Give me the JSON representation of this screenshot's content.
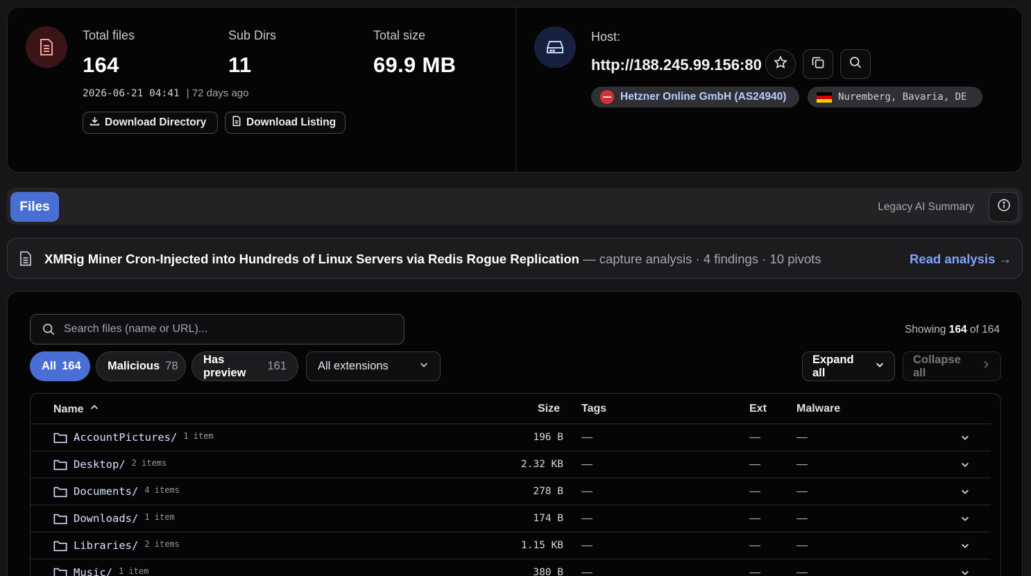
{
  "summary": {
    "total_files_label": "Total files",
    "total_files_value": "164",
    "sub_dirs_label": "Sub Dirs",
    "sub_dirs_value": "11",
    "total_size_label": "Total size",
    "total_size_value": "69.9 MB",
    "timestamp": "2026-06-21 04:41",
    "relative_time": "| 72 days ago",
    "download_directory_label": "Download Directory",
    "download_listing_label": "Download Listing"
  },
  "host": {
    "label": "Host:",
    "url": "http://188.245.99.156:80",
    "asn": "Hetzner Online GmbH (AS24940)",
    "location": "Nuremberg, Bavaria, DE",
    "flag_colors": [
      "#000000",
      "#dd0000",
      "#ffce00"
    ]
  },
  "tabs": {
    "files_label": "Files",
    "legacy_label": "Legacy AI Summary"
  },
  "banner": {
    "title": "XMRig Miner Cron-Injected into Hundreds of Linux Servers via Redis Rogue Replication",
    "meta": " — capture analysis · 4 findings · 10 pivots",
    "link": "Read analysis →"
  },
  "files": {
    "search_placeholder": "Search files (name or URL)...",
    "showing_prefix": "Showing ",
    "showing_count": "164",
    "showing_suffix": " of 164",
    "filters": {
      "all_label": "All",
      "all_count": "164",
      "malicious_label": "Malicious",
      "malicious_count": "78",
      "preview_label": "Has preview",
      "preview_count": "161",
      "extensions_label": "All extensions"
    },
    "expand_all": "Expand all",
    "collapse_all": "Collapse all",
    "columns": {
      "name": "Name",
      "size": "Size",
      "tags": "Tags",
      "ext": "Ext",
      "malware": "Malware"
    },
    "rows": [
      {
        "name": "AccountPictures/",
        "count": "1 item",
        "size": "196 B"
      },
      {
        "name": "Desktop/",
        "count": "2 items",
        "size": "2.32 KB"
      },
      {
        "name": "Documents/",
        "count": "4 items",
        "size": "278 B"
      },
      {
        "name": "Downloads/",
        "count": "1 item",
        "size": "174 B"
      },
      {
        "name": "Libraries/",
        "count": "2 items",
        "size": "1.15 KB"
      },
      {
        "name": "Music/",
        "count": "1 item",
        "size": "380 B"
      }
    ]
  },
  "colors": {
    "accent": "#4a6fd4",
    "link": "#7fa4ff",
    "danger_bg": "#3a1416"
  }
}
